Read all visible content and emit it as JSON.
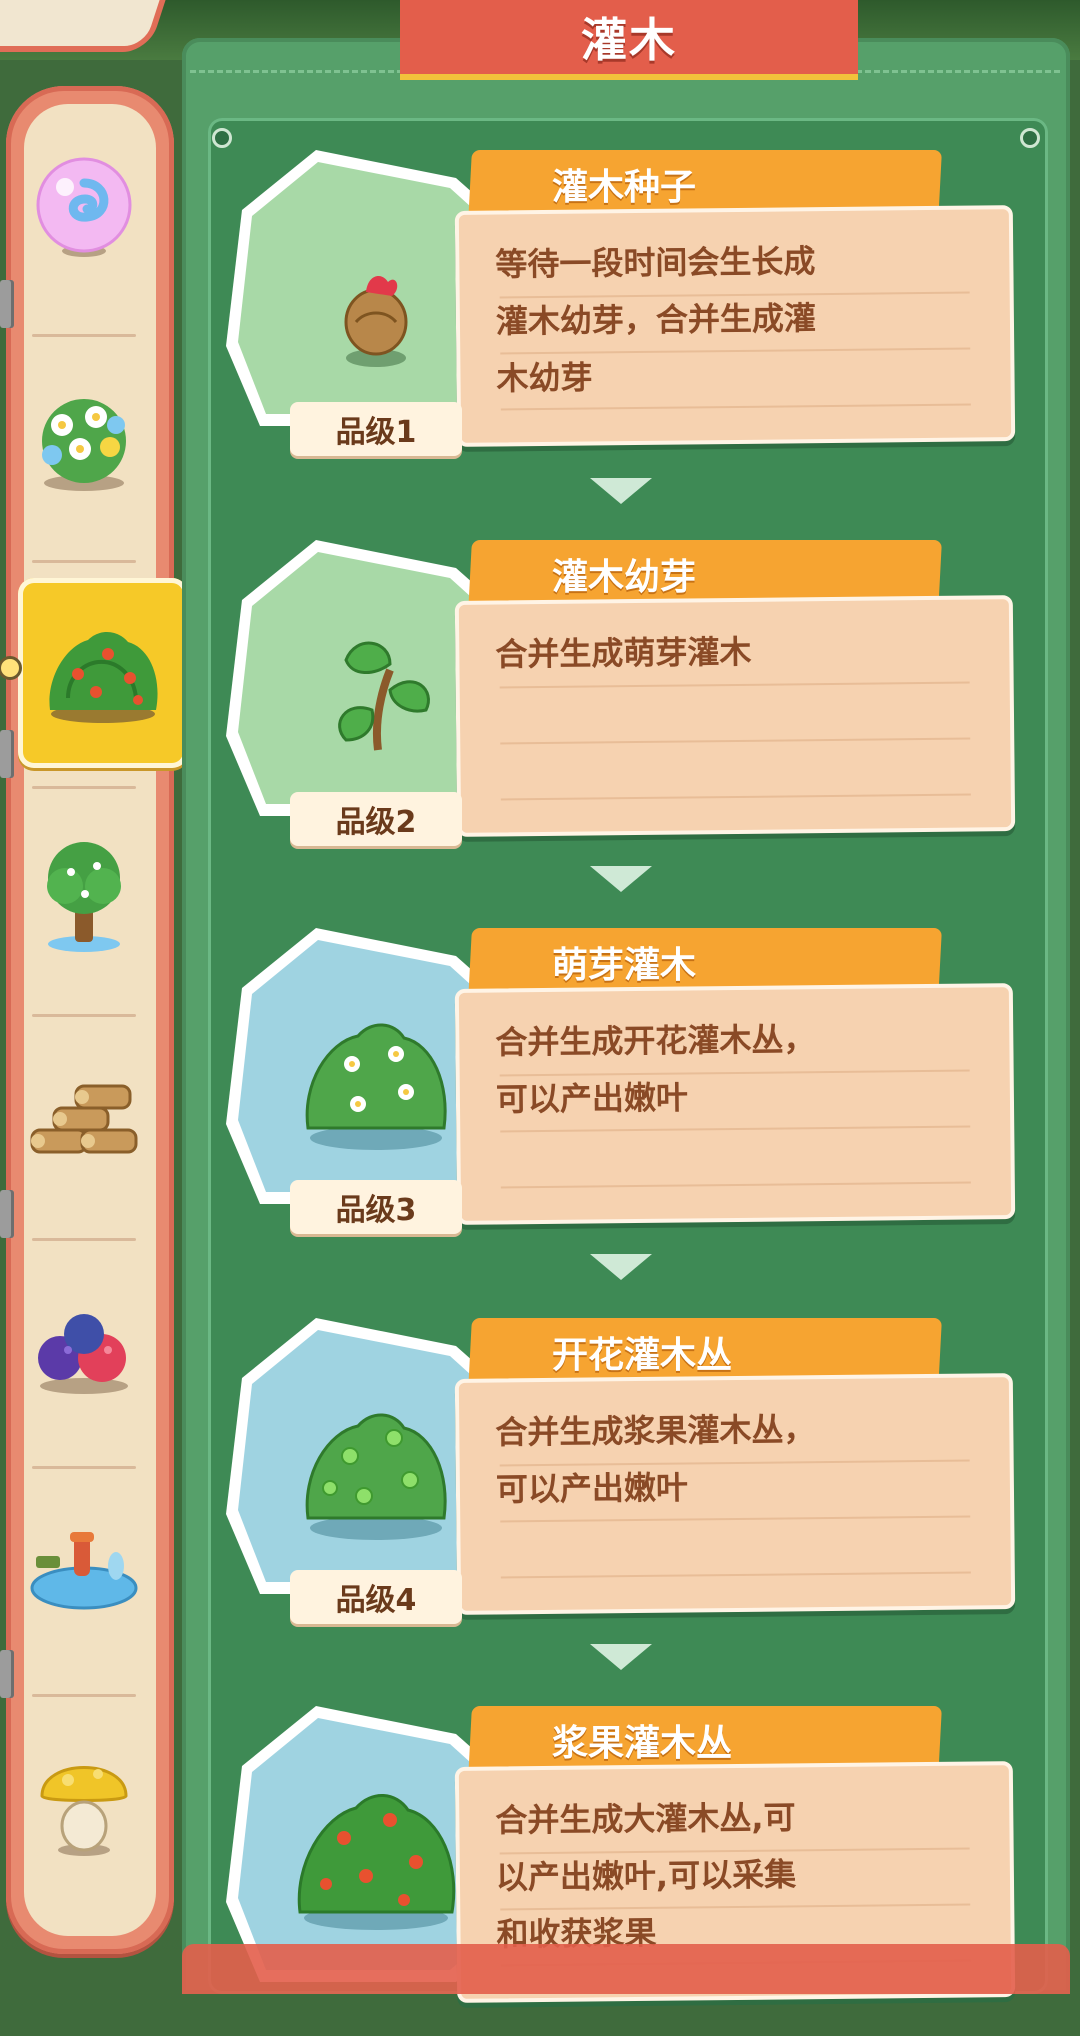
{
  "title": "灌木",
  "categories": [
    {
      "name": "bubble-orb-icon",
      "active": false
    },
    {
      "name": "flower-bush-icon",
      "active": false
    },
    {
      "name": "berry-shrub-icon",
      "active": true
    },
    {
      "name": "tree-icon",
      "active": false
    },
    {
      "name": "wood-logs-icon",
      "active": false
    },
    {
      "name": "berries-icon",
      "active": false
    },
    {
      "name": "pond-icon",
      "active": false
    },
    {
      "name": "mushroom-icon",
      "active": false
    }
  ],
  "items": [
    {
      "name": "灌木种子",
      "desc": [
        "等待一段时间会生长成",
        "灌木幼芽，合并生成灌",
        "木幼芽"
      ],
      "grade": "品级1",
      "bg": "#a8d9a7",
      "icon": "seed-icon"
    },
    {
      "name": "灌木幼芽",
      "desc": [
        "合并生成萌芽灌木"
      ],
      "grade": "品级2",
      "bg": "#a8d9a7",
      "icon": "sprout-icon"
    },
    {
      "name": "萌芽灌木",
      "desc": [
        "合并生成开花灌木丛，",
        "可以产出嫩叶"
      ],
      "grade": "品级3",
      "bg": "#9fd3e1",
      "icon": "flowering-shrub-icon"
    },
    {
      "name": "开花灌木丛",
      "desc": [
        "合并生成浆果灌木丛，",
        "可以产出嫩叶"
      ],
      "grade": "品级4",
      "bg": "#9fd3e1",
      "icon": "green-berry-shrub-icon"
    },
    {
      "name": "浆果灌木丛",
      "desc": [
        "合并生成大灌木丛,可",
        "以产出嫩叶,可以采集",
        "和收获浆果"
      ],
      "grade": "",
      "bg": "#9fd3e1",
      "icon": "red-berry-shrub-icon"
    }
  ]
}
